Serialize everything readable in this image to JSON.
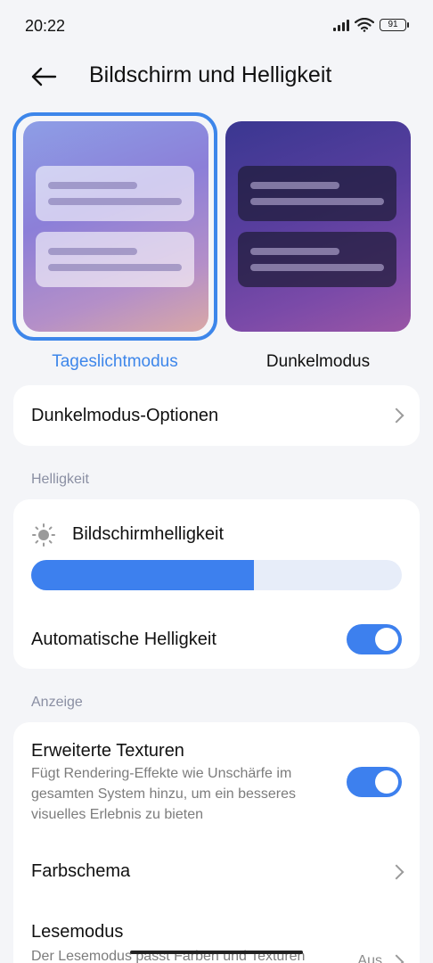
{
  "status_bar": {
    "time": "20:22",
    "battery": "91"
  },
  "header": {
    "title": "Bildschirm und Helligkeit"
  },
  "modes": {
    "light_label": "Tageslichtmodus",
    "dark_label": "Dunkelmodus",
    "selected": "light"
  },
  "dark_options": {
    "label": "Dunkelmodus-Optionen"
  },
  "brightness_section": {
    "header": "Helligkeit",
    "screen_brightness_label": "Bildschirmhelligkeit",
    "brightness_level": 0.6,
    "auto_brightness_label": "Automatische Helligkeit",
    "auto_brightness_on": true
  },
  "display_section": {
    "header": "Anzeige",
    "textures_title": "Erweiterte Texturen",
    "textures_desc": "Fügt Rendering-Effekte wie Unschärfe im gesamten System hinzu, um ein besseres visuelles Erlebnis zu bieten",
    "textures_on": true,
    "color_scheme_label": "Farbschema",
    "reading_mode_title": "Lesemodus",
    "reading_mode_desc": "Der Lesemodus passt Farben und Texturen",
    "reading_mode_value": "Aus"
  },
  "colors": {
    "accent": "#3d80ee"
  }
}
